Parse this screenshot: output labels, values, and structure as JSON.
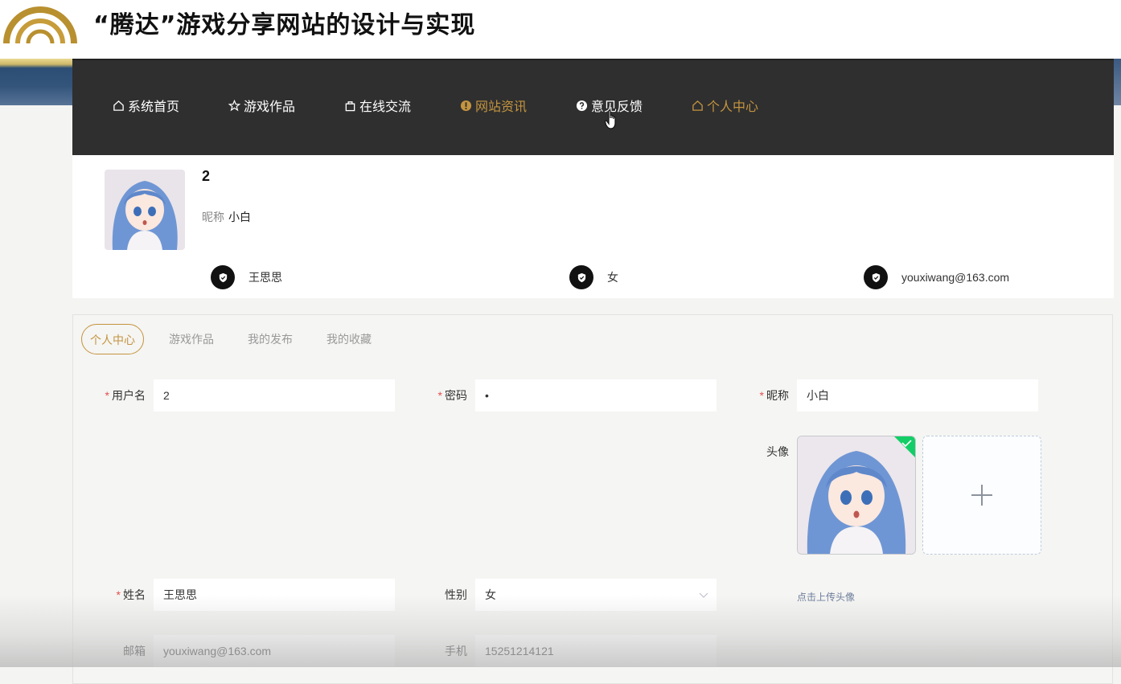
{
  "page": {
    "title": "“腾达”游戏分享网站的设计与实现"
  },
  "nav": {
    "items": [
      {
        "label": "系统首页",
        "icon": "home-icon",
        "active": false
      },
      {
        "label": "游戏作品",
        "icon": "star-icon",
        "active": false
      },
      {
        "label": "在线交流",
        "icon": "bag-icon",
        "active": false
      },
      {
        "label": "网站资讯",
        "icon": "info-icon",
        "active": true
      },
      {
        "label": "意见反馈",
        "icon": "question-icon",
        "active": false
      },
      {
        "label": "个人中心",
        "icon": "home-icon",
        "active": true
      }
    ],
    "active_color": "#c4943f"
  },
  "profile": {
    "username": "2",
    "nickname_label": "昵称",
    "nickname": "小白",
    "chips": [
      {
        "icon": "shield-icon",
        "value": "王思思"
      },
      {
        "icon": "shield-icon",
        "value": "女"
      },
      {
        "icon": "shield-icon",
        "value": "youxiwang@163.com"
      }
    ]
  },
  "tabs": [
    {
      "label": "个人中心",
      "active": true
    },
    {
      "label": "游戏作品",
      "active": false
    },
    {
      "label": "我的发布",
      "active": false
    },
    {
      "label": "我的收藏",
      "active": false
    }
  ],
  "form": {
    "username": {
      "label": "用户名",
      "required": true,
      "value": "2"
    },
    "password": {
      "label": "密码",
      "required": true,
      "value": "•"
    },
    "nickname": {
      "label": "昵称",
      "required": true,
      "value": "小白"
    },
    "avatar": {
      "label": "头像",
      "hint": "点击上传头像",
      "uploaded": true
    },
    "realname": {
      "label": "姓名",
      "required": true,
      "value": "王思思"
    },
    "gender": {
      "label": "性别",
      "required": false,
      "value": "女"
    },
    "email": {
      "label": "邮箱",
      "required": false,
      "value": "youxiwang@163.com"
    },
    "phone": {
      "label": "手机",
      "required": false,
      "value": "15251214121"
    }
  }
}
